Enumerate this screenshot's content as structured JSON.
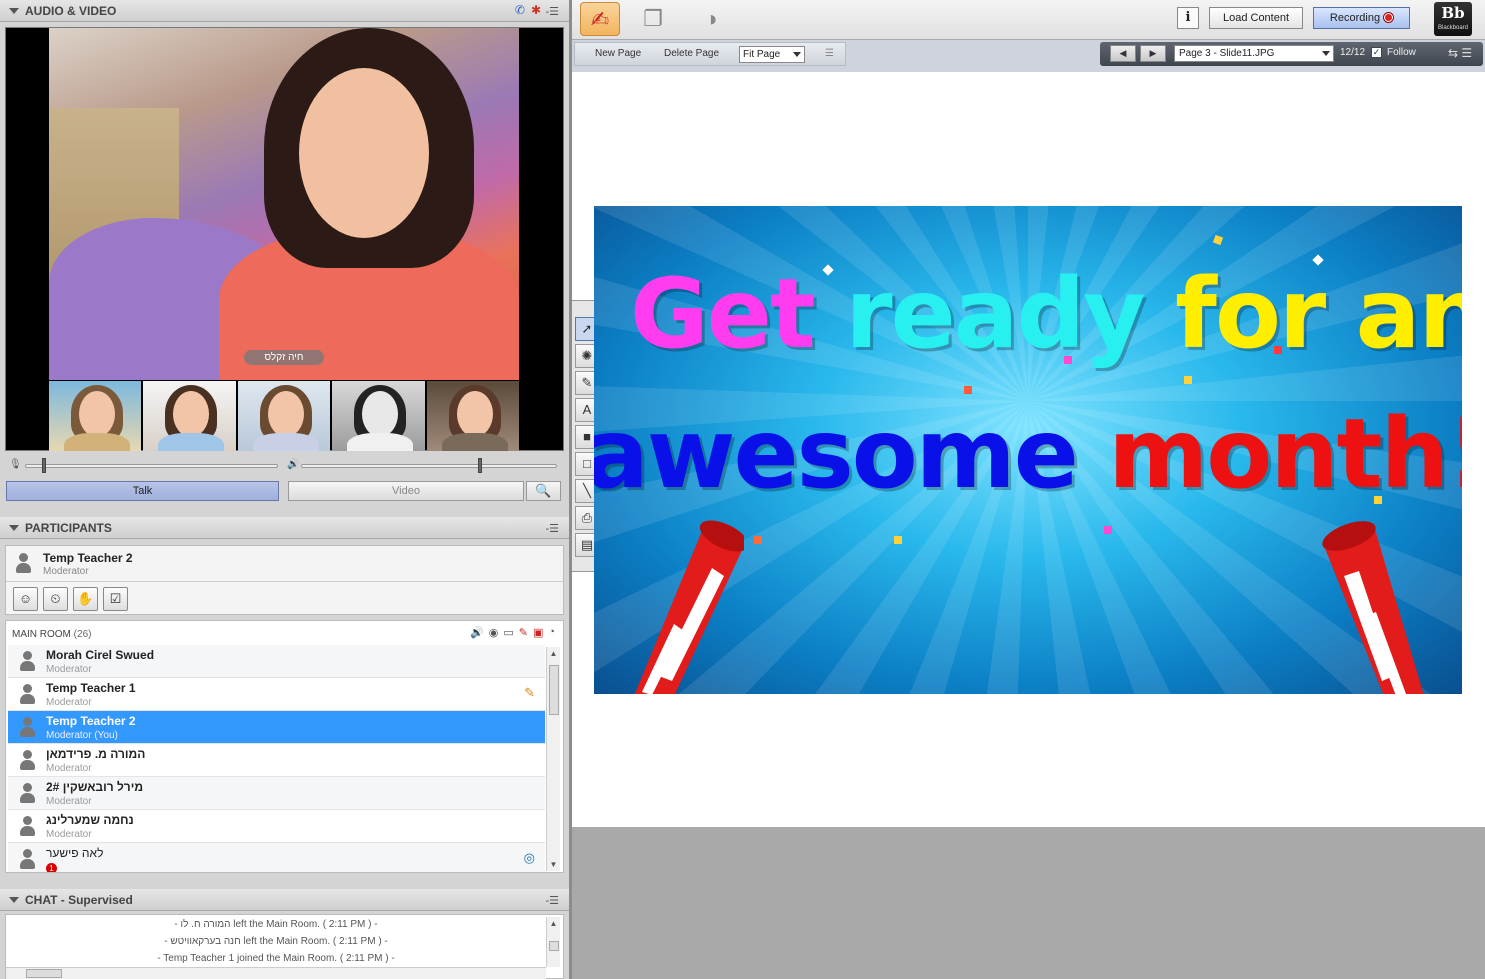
{
  "left_panel": {
    "audio_video": {
      "title": "AUDIO & VIDEO",
      "main_video_name": "חיה זקלס",
      "talk_label": "Talk",
      "video_label": "Video"
    },
    "participants": {
      "title": "PARTICIPANTS",
      "me": {
        "name": "Temp Teacher 2",
        "role": "Moderator"
      },
      "room": {
        "name": "MAIN ROOM",
        "count": "(26)"
      },
      "list": [
        {
          "name": "Morah Cirel Swued",
          "role": "Moderator"
        },
        {
          "name": "Temp Teacher 1",
          "role": "Moderator"
        },
        {
          "name": "Temp Teacher 2",
          "role": "Moderator (You)"
        },
        {
          "name": "המורה מ. פרידמאן",
          "role": "Moderator"
        },
        {
          "name": "מירל רובאשקין 2#",
          "role": "Moderator"
        },
        {
          "name": "נחמה שמערלינג",
          "role": "Moderator"
        },
        {
          "name": "לאה פישער",
          "role": "",
          "badge": "1"
        }
      ]
    },
    "chat": {
      "title": "CHAT - Supervised",
      "messages": [
        "- המורה ח. לו left the Main Room. ( 2:11 PM ) -",
        "- חנה בערקאוויטש left the Main Room. ( 2:11 PM ) -",
        "- Temp Teacher 1 joined the Main Room. ( 2:11 PM ) -"
      ]
    }
  },
  "toolbar": {
    "load_content": "Load Content",
    "recording": "Recording",
    "info_icon": "i",
    "brand": "Bb",
    "brand_text": "Blackboard"
  },
  "page_toolbar": {
    "new_page": "New Page",
    "delete_page": "Delete Page",
    "fit": "Fit Page",
    "page_select": "Page 3 - Slide11.JPG",
    "page_count": "12/12",
    "follow": "Follow",
    "follow_checked": true
  },
  "slide": {
    "line1": [
      "Get",
      "ready",
      "for",
      "an"
    ],
    "line2": [
      "awesome",
      "month!!!!"
    ],
    "colors": {
      "get": "#ff3cf0",
      "ready": "#29f0f0",
      "for_an": "#ffee00",
      "awesome": "#0a10e8",
      "month": "#ee1111"
    }
  }
}
